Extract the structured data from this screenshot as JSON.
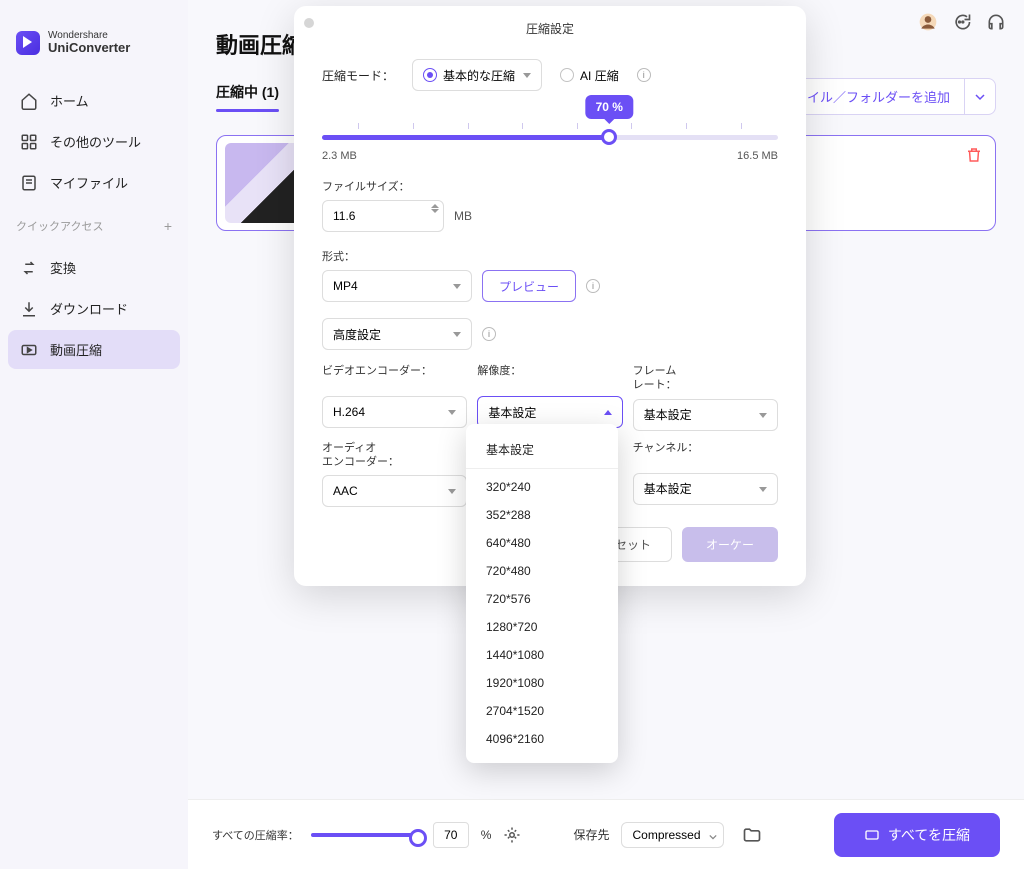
{
  "brand": {
    "top": "Wondershare",
    "name": "UniConverter"
  },
  "sidebar": {
    "nav": [
      {
        "label": "ホーム",
        "icon": "home"
      },
      {
        "label": "その他のツール",
        "icon": "grid"
      },
      {
        "label": "マイファイル",
        "icon": "file"
      }
    ],
    "quick_header": "クイックアクセス",
    "quick": [
      {
        "label": "変換",
        "icon": "swap"
      },
      {
        "label": "ダウンロード",
        "icon": "download"
      },
      {
        "label": "動画圧縮",
        "icon": "compress",
        "active": true
      }
    ]
  },
  "header_icons": [
    "avatar",
    "chat",
    "headset"
  ],
  "page_title": "動画圧縮",
  "tabs": {
    "compressing": "圧縮中 (1)"
  },
  "add_button": "ファイル／フォルダーを追加",
  "modal": {
    "title": "圧縮設定",
    "mode_label": "圧縮モード：",
    "mode_basic": "基本的な圧縮",
    "mode_ai": "AI 圧縮",
    "slider": {
      "percent": "70 %",
      "min_label": "2.3 MB",
      "max_label": "16.5 MB",
      "value_pct": 63
    },
    "filesize_label": "ファイルサイズ：",
    "filesize_value": "11.6",
    "unit_mb": "MB",
    "format_label": "形式：",
    "format_value": "MP4",
    "preview_btn": "プレビュー",
    "advanced_value": "高度設定",
    "cols": {
      "video_enc_label": "ビデオエンコーダー：",
      "video_enc_value": "H.264",
      "resolution_label": "解像度：",
      "resolution_value": "基本設定",
      "framerate_label": "フレーム\nレート：",
      "framerate_value": "基本設定",
      "audio_enc_label": "オーディオ\nエンコーダー：",
      "audio_enc_value": "AAC",
      "channel_label": "チャンネル：",
      "channel_value": "基本設定"
    },
    "reset_btn": "リセット",
    "ok_btn": "オーケー"
  },
  "resolution_options": [
    "基本設定",
    "320*240",
    "352*288",
    "640*480",
    "720*480",
    "720*576",
    "1280*720",
    "1440*1080",
    "1920*1080",
    "2704*1520",
    "4096*2160"
  ],
  "bottom": {
    "ratio_label": "すべての圧縮率：",
    "ratio_value": "70",
    "pct_sign": "%",
    "save_label": "保存先",
    "save_value": "Compressed",
    "compress_all": "すべてを圧縮"
  }
}
